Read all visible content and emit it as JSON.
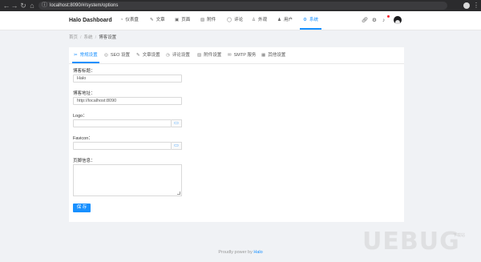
{
  "browser": {
    "url": "localhost:8090/#/system/options"
  },
  "header": {
    "brand": "Halo  Dashboard",
    "menu": [
      {
        "label": "仪表盘",
        "icon": "dashboard-icon"
      },
      {
        "label": "文章",
        "icon": "form-icon"
      },
      {
        "label": "页面",
        "icon": "read-icon"
      },
      {
        "label": "附件",
        "icon": "picture-icon"
      },
      {
        "label": "评论",
        "icon": "message-icon"
      },
      {
        "label": "外观",
        "icon": "skin-icon"
      },
      {
        "label": "用户",
        "icon": "user-icon"
      },
      {
        "label": "系统",
        "icon": "setting-icon"
      }
    ],
    "active_menu": "系统"
  },
  "breadcrumb": {
    "items": [
      "首页",
      "系统",
      "博客设置"
    ]
  },
  "tabs": [
    {
      "label": "常规设置",
      "icon": "tool-icon"
    },
    {
      "label": "SEO 设置",
      "icon": "global-icon"
    },
    {
      "label": "文章设置",
      "icon": "edit-icon"
    },
    {
      "label": "评论设置",
      "icon": "comment-icon"
    },
    {
      "label": "附件设置",
      "icon": "picture-icon"
    },
    {
      "label": "SMTP 服务",
      "icon": "mail-icon"
    },
    {
      "label": "其他设置",
      "icon": "other-icon"
    }
  ],
  "active_tab": "常规设置",
  "form": {
    "blog_title_label": "博客标题：",
    "blog_title_value": "Halo",
    "blog_url_label": "博客地址：",
    "blog_url_value": "http://localhost:8090",
    "logo_label": "Logo：",
    "logo_value": "",
    "favicon_label": "Favicon：",
    "favicon_value": "",
    "footer_info_label": "页脚信息：",
    "save_label": "保 存"
  },
  "footer": {
    "text": "Proudly power by ",
    "link": "Halo"
  },
  "watermark": {
    "text": "UEBUG",
    "sub": "下载站"
  },
  "colors": {
    "accent": "#1890ff",
    "page_bg": "#f0f2f5"
  }
}
